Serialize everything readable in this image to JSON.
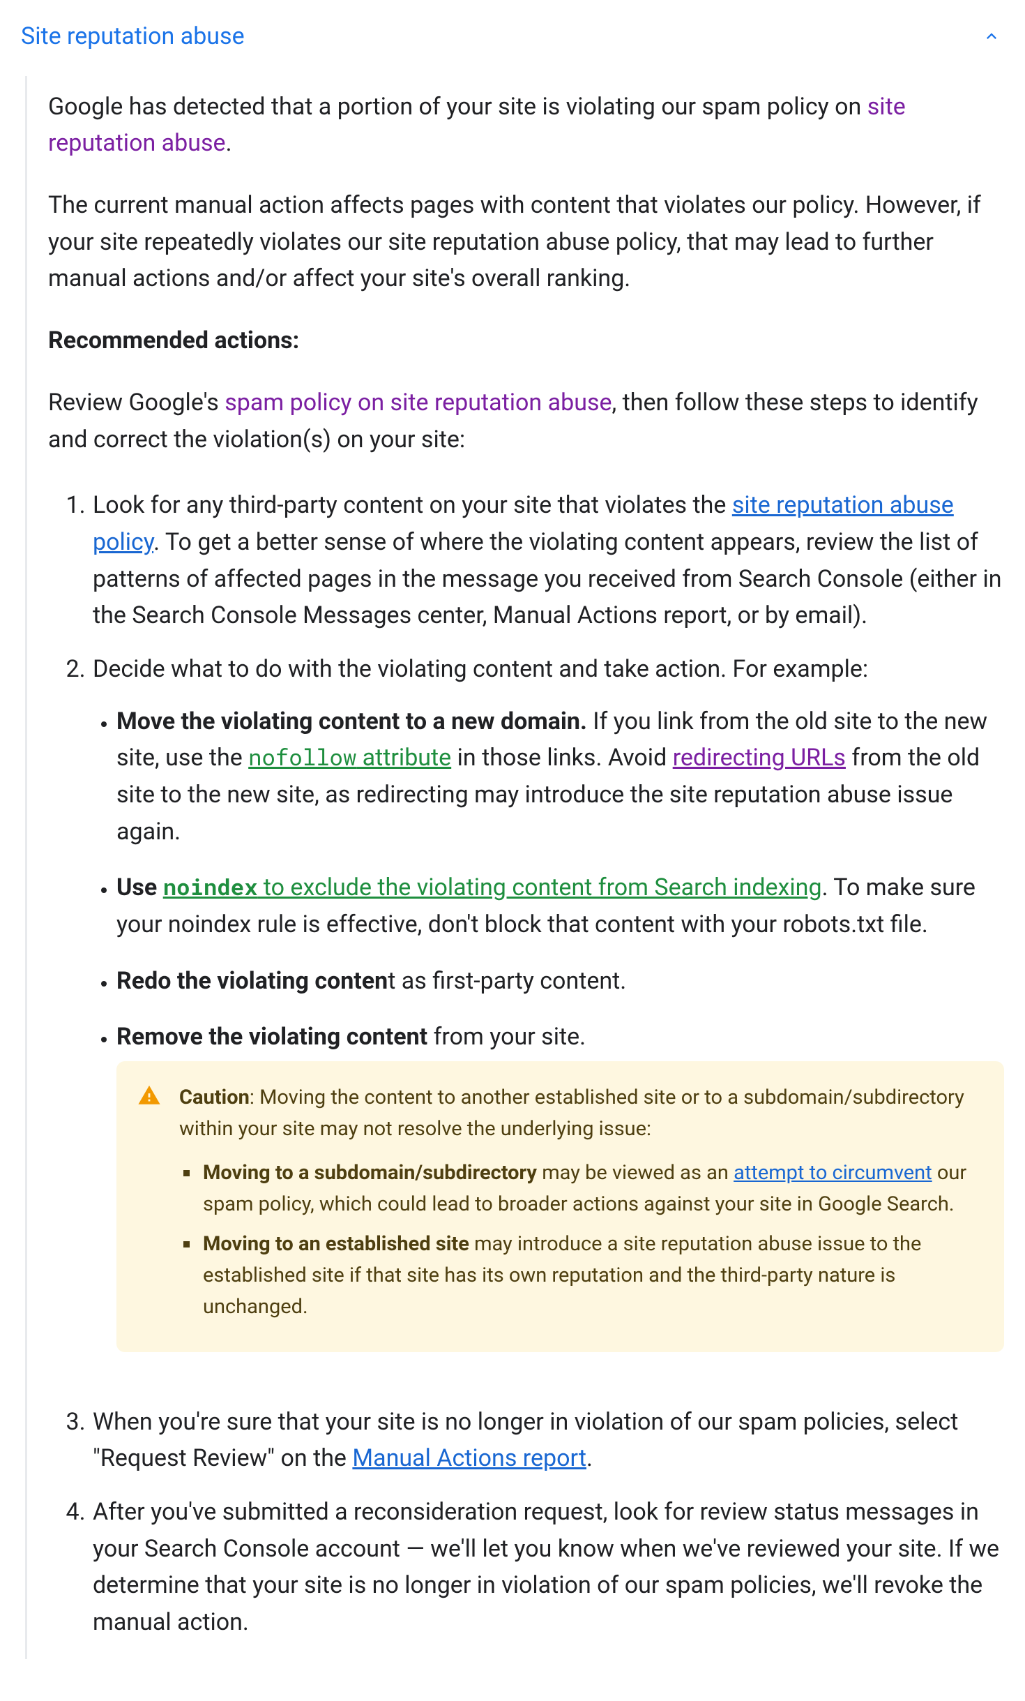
{
  "title": "Site reputation abuse",
  "intro": {
    "pre": "Google has detected that a portion of your site is violating our spam policy on ",
    "link": "site reputation abuse",
    "post": "."
  },
  "intro2": "The current manual action affects pages with content that violates our policy. However, if your site repeatedly violates our site reputation abuse policy, that may lead to further manual actions and/or affect your site's overall ranking.",
  "recHeading": "Recommended actions:",
  "review": {
    "pre": "Review Google's ",
    "link": "spam policy on site reputation abuse",
    "post": ", then follow these steps to identify and correct the violation(s) on your site:"
  },
  "step1": {
    "pre": "Look for any third-party content on your site that violates the ",
    "link": "site reputation abuse policy",
    "post": ". To get a better sense of where the violating content appears, review the list of patterns of affected pages in the message you received from Search Console (either in the Search Console Messages center, Manual Actions report, or by email)."
  },
  "step2": {
    "lead": "Decide what to do with the violating content and take action. For example:",
    "optA": {
      "bold": "Move the violating content to a new domain.",
      "t1": " If you link from the old site to the new site, use the ",
      "codeLink1a": "nofollow",
      "codeLink1b": " attribute",
      "t2": " in those links. Avoid ",
      "link2": "redirecting URLs",
      "t3": " from the old site to the new site, as redirecting may introduce the site reputation abuse issue again."
    },
    "optB": {
      "bold": "Use ",
      "codeLink_a": "noindex",
      "codeLink_b": " to exclude the violating content from Search indexing",
      "tail": ". To make sure your noindex rule is effective, don't block that content with your robots.txt file."
    },
    "optC": {
      "bold": "Redo the violating conten",
      "tail": "t as first-party content."
    },
    "optD": {
      "bold": "Remove the violating content",
      "tail": " from your site."
    }
  },
  "caution": {
    "label": "Caution",
    "lead": ": Moving the content to another established site or to a subdomain/subdirectory within your site may not resolve the underlying issue:",
    "b1": {
      "bold": "Moving to a subdomain/subdirectory",
      "t1": " may be viewed as an ",
      "link": "attempt to circumvent",
      "t2": " our spam policy, which could lead to broader actions against your site in Google Search."
    },
    "b2": {
      "bold": "Moving to an established site",
      "tail": " may introduce a site reputation abuse issue to the established site if that site has its own reputation and the third-party nature is unchanged."
    }
  },
  "step3": {
    "pre": "When you're sure that your site is no longer in violation of our spam policies, select \"Request Review\" on the ",
    "link": "Manual Actions report",
    "post": "."
  },
  "step4": "After you've submitted a reconsideration request, look for review status messages in your Search Console account — we'll let you know when we've reviewed your site. If we determine that your site is no longer in violation of our spam policies, we'll revoke the manual action."
}
